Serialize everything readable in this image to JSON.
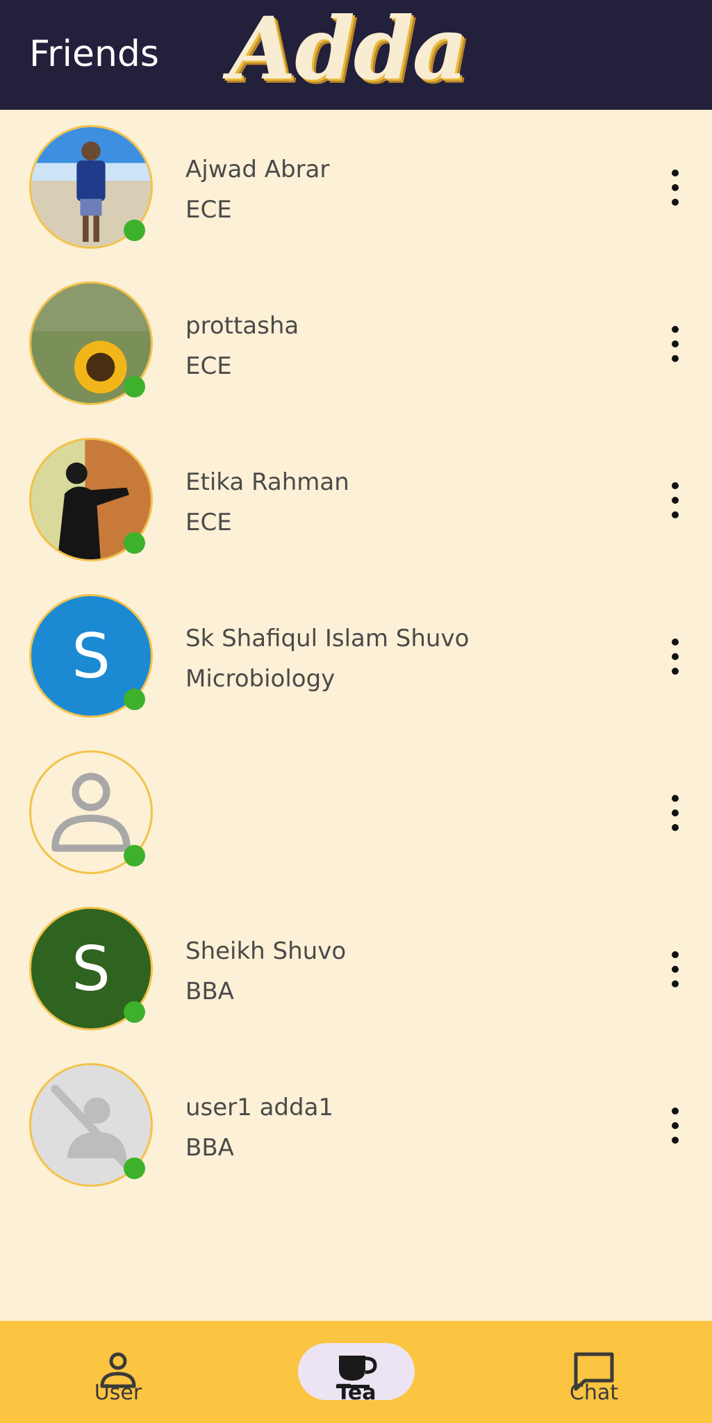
{
  "header": {
    "title": "Friends",
    "brand": "Adda"
  },
  "friends": [
    {
      "name": "Ajwad Abrar",
      "dept": "ECE",
      "avatar": "photo-beach"
    },
    {
      "name": "prottasha",
      "dept": "ECE",
      "avatar": "photo-sunflower"
    },
    {
      "name": "Etika Rahman",
      "dept": "ECE",
      "avatar": "photo-speaker"
    },
    {
      "name": "Sk Shafiqul Islam Shuvo",
      "dept": "Microbiology",
      "avatar_letter": "S",
      "avatar_color": "#1b8ad3"
    },
    {
      "name": "",
      "dept": "",
      "avatar": "default-person-icon"
    },
    {
      "name": "Sheikh Shuvo",
      "dept": "BBA",
      "avatar_letter": "S",
      "avatar_color": "#2f6320"
    },
    {
      "name": "user1 adda1",
      "dept": "BBA",
      "avatar": "no-image-icon"
    }
  ],
  "nav": {
    "user": "User",
    "tea": "Tea",
    "chat": "Chat",
    "active": "Tea"
  },
  "colors": {
    "header_bg": "#22203a",
    "page_bg": "#fcf0d6",
    "nav_bg": "#fbc441",
    "online": "#3db12b",
    "avatar_ring": "#f3c24a"
  }
}
